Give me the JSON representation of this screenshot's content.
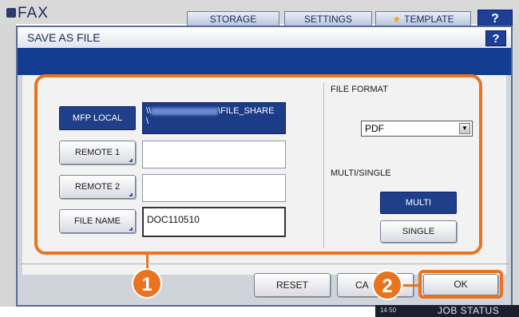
{
  "background": {
    "app_title": "FAX",
    "tabs": [
      {
        "label": "STORAGE"
      },
      {
        "label": "SETTINGS"
      },
      {
        "label": "TEMPLATE"
      }
    ],
    "help_label": "?",
    "job_status_label": "JOB STATUS",
    "clock": "14 50"
  },
  "dialog": {
    "title": "SAVE AS FILE",
    "help_label": "?",
    "mfp_local_label": "MFP LOCAL",
    "mfp_local_path_suffix": "\\FILE_SHARE",
    "mfp_local_path_prefix": "\\\\",
    "mfp_local_path_line2": "\\",
    "remote1_label": "REMOTE 1",
    "remote1_value": "",
    "remote2_label": "REMOTE 2",
    "remote2_value": "",
    "file_name_label": "FILE NAME",
    "file_name_value": "DOC110510",
    "file_format_label": "FILE FORMAT",
    "file_format_value": "PDF",
    "multi_single_label": "MULTI/SINGLE",
    "multi_label": "MULTI",
    "single_label": "SINGLE",
    "reset_label": "RESET",
    "cancel_label": "CA",
    "ok_label": "OK"
  },
  "callouts": {
    "one": "1",
    "two": "2"
  },
  "colors": {
    "accent_orange": "#e9731f",
    "active_blue": "#1f3f8a",
    "title_band": "#123c8f"
  }
}
